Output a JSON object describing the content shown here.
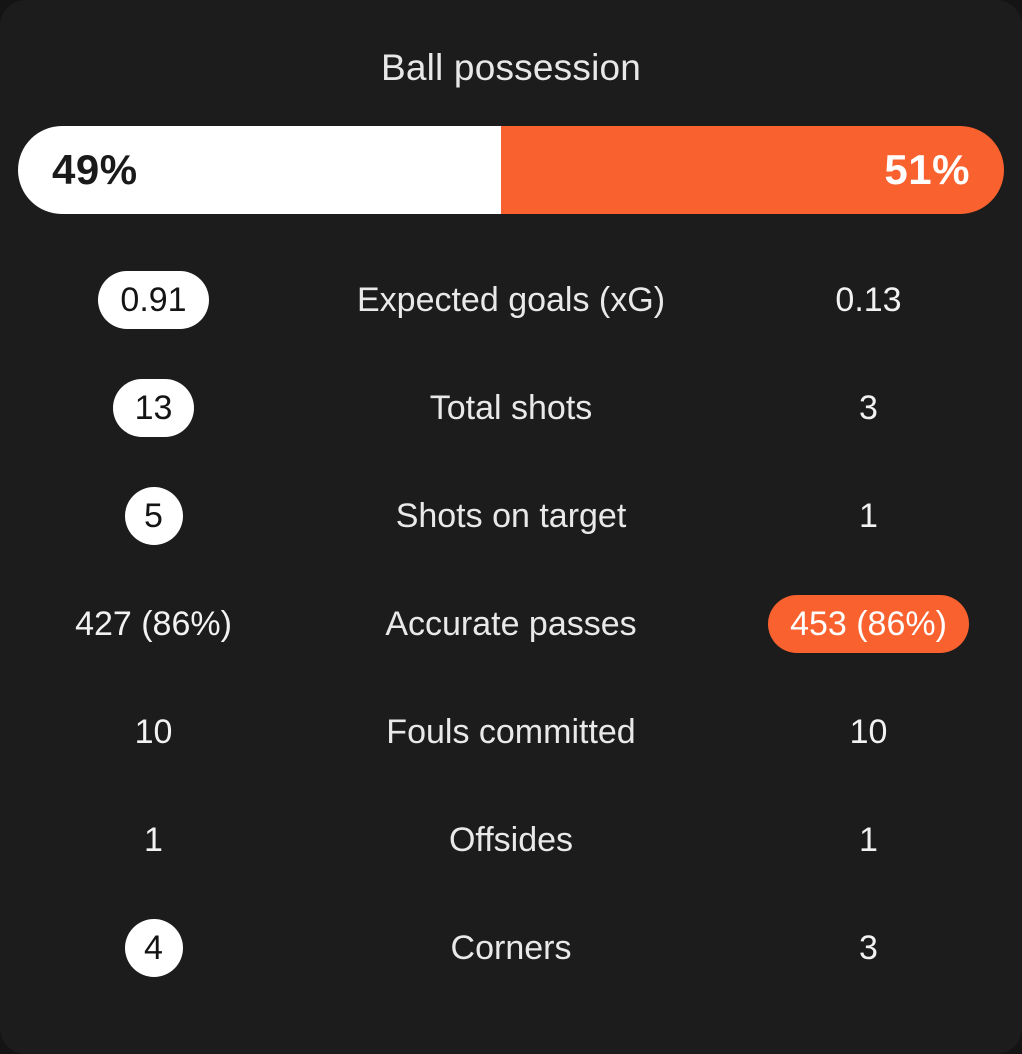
{
  "theme": {
    "background": "#141414",
    "card_background": "#1c1c1c",
    "accent_orange": "#f9612f",
    "highlight_white": "#ffffff",
    "text_primary": "#f2f2f2"
  },
  "header": {
    "title": "Ball possession"
  },
  "possession": {
    "home_label": "49%",
    "away_label": "51%",
    "home_pct": 49,
    "away_pct": 51
  },
  "stats": [
    {
      "label": "Expected goals (xG)",
      "home": "0.91",
      "away": "0.13",
      "home_style": "pill-white",
      "away_style": "plain"
    },
    {
      "label": "Total shots",
      "home": "13",
      "away": "3",
      "home_style": "pill-white",
      "away_style": "plain"
    },
    {
      "label": "Shots on target",
      "home": "5",
      "away": "1",
      "home_style": "pill-white narrow",
      "away_style": "plain"
    },
    {
      "label": "Accurate passes",
      "home": "427 (86%)",
      "away": "453 (86%)",
      "home_style": "plain",
      "away_style": "pill-orange"
    },
    {
      "label": "Fouls committed",
      "home": "10",
      "away": "10",
      "home_style": "plain",
      "away_style": "plain"
    },
    {
      "label": "Offsides",
      "home": "1",
      "away": "1",
      "home_style": "plain",
      "away_style": "plain"
    },
    {
      "label": "Corners",
      "home": "4",
      "away": "3",
      "home_style": "pill-white narrow",
      "away_style": "plain"
    }
  ],
  "chart_data": {
    "type": "bar",
    "title": "Ball possession",
    "categories": [
      "Home",
      "Away"
    ],
    "values": [
      49,
      51
    ],
    "unit": "%",
    "xlabel": "",
    "ylabel": "Possession",
    "ylim": [
      0,
      100
    ],
    "table": {
      "columns": [
        "Home",
        "Statistic",
        "Away"
      ],
      "rows": [
        [
          "49%",
          "Ball possession",
          "51%"
        ],
        [
          "0.91",
          "Expected goals (xG)",
          "0.13"
        ],
        [
          "13",
          "Total shots",
          "3"
        ],
        [
          "5",
          "Shots on target",
          "1"
        ],
        [
          "427 (86%)",
          "Accurate passes",
          "453 (86%)"
        ],
        [
          "10",
          "Fouls committed",
          "10"
        ],
        [
          "1",
          "Offsides",
          "1"
        ],
        [
          "4",
          "Corners",
          "3"
        ]
      ]
    }
  }
}
